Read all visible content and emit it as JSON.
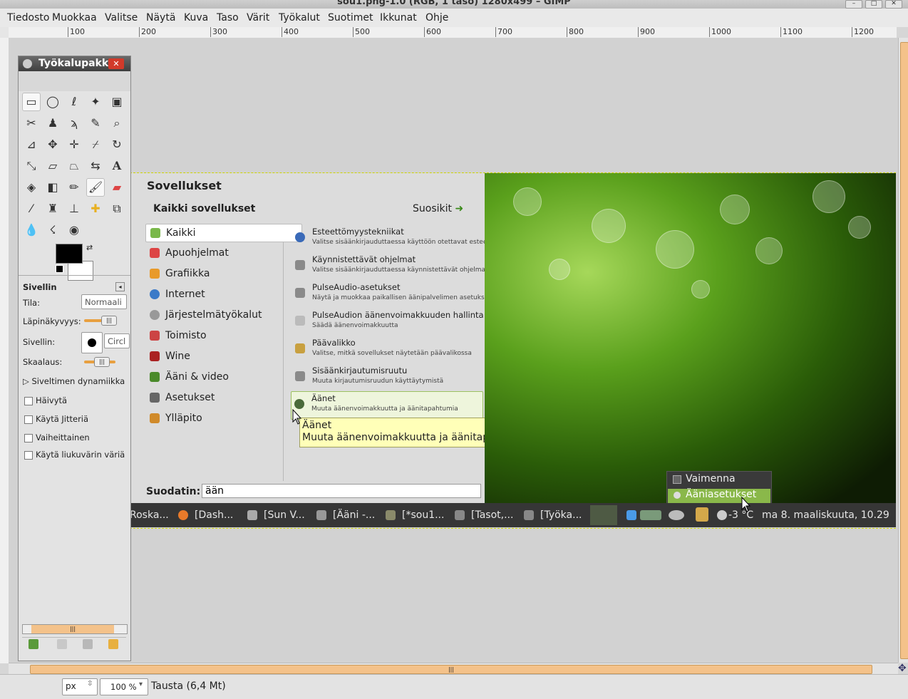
{
  "window": {
    "title": "sou1.png-1.0 (RGB, 1 taso) 1280x499 – GIMP"
  },
  "menubar": [
    "Tiedosto",
    "Muokkaa",
    "Valitse",
    "Näytä",
    "Kuva",
    "Taso",
    "Värit",
    "Työkalut",
    "Suotimet",
    "Ikkunat",
    "Ohje"
  ],
  "ruler_ticks": [
    "100",
    "200",
    "300",
    "400",
    "500",
    "600",
    "700",
    "800",
    "900",
    "1000",
    "1100",
    "1200"
  ],
  "toolbox": {
    "title": "Työkalupakki",
    "close": "✕",
    "section": "Sivellin",
    "mode_label": "Tila:",
    "mode_value": "Normaali",
    "opacity_label": "Läpinäkyvyys:",
    "brush_label": "Sivellin:",
    "brush_value": "Circl",
    "scale_label": "Skaalaus:",
    "dynamics_label": "Siveltimen dynamiikka",
    "checks": [
      "Häivytä",
      "Käytä Jitteriä",
      "Vaiheittainen",
      "Käytä liukuvärin väriä"
    ]
  },
  "app_menu": {
    "header": "Sovellukset",
    "all_apps": "Kaikki sovellukset",
    "favorites": "Suosikit",
    "categories": [
      "Kaikki",
      "Apuohjelmat",
      "Grafiikka",
      "Internet",
      "Järjestelmätyökalut",
      "Toimisto",
      "Wine",
      "Ääni & video",
      "Asetukset",
      "Ylläpito"
    ],
    "apps": [
      {
        "name": "Esteettömyystekniikat",
        "desc": "Valitse sisäänkirjauduttaessa käyttöön otettavat esteett..."
      },
      {
        "name": "Käynnistettävät ohjelmat",
        "desc": "Valitse sisäänkirjauduttaessa käynnistettävät ohjelmat"
      },
      {
        "name": "PulseAudio-asetukset",
        "desc": "Näytä ja muokkaa paikallisen äänipalvelimen asetuksia"
      },
      {
        "name": "PulseAudion äänenvoimakkuuden hallinta",
        "desc": "Säädä äänenvoimakkuutta"
      },
      {
        "name": "Päävalikko",
        "desc": "Valitse, mitkä sovellukset näytetään päävalikossa"
      },
      {
        "name": "Sisäänkirjautumisruutu",
        "desc": "Muuta kirjautumisruudun käyttäytymistä"
      },
      {
        "name": "Äänet",
        "desc": "Muuta äänenvoimakkuutta ja äänitapahtumia"
      }
    ],
    "tooltip_title": "Äänet",
    "tooltip_desc": "Muuta äänenvoimakkuutta ja äänitapahtumia",
    "filter_label": "Suodatin:",
    "filter_value": "ään"
  },
  "volume_menu": {
    "mute": "Vaimenna",
    "settings": "Ääniasetukset"
  },
  "taskbar": {
    "items": [
      "Roska...",
      "[Dash...",
      "[Sun V...",
      "[Ääni -...",
      "[*sou1...",
      "[Tasot,...",
      "[Työka..."
    ],
    "temperature": "-3 °C",
    "clock": "ma  8. maaliskuuta, 10.29"
  },
  "status": {
    "unit": "px",
    "zoom": "100 %",
    "layer": "Tausta (6,4 Mt)"
  }
}
